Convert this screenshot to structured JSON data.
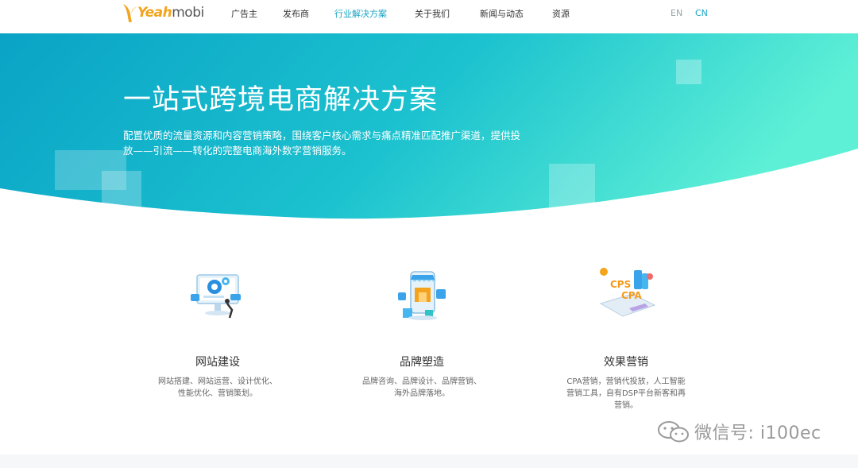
{
  "header": {
    "logo_highlight": "Yeah",
    "logo_rest": "mobi",
    "nav": [
      {
        "label": "广告主",
        "active": false
      },
      {
        "label": "发布商",
        "active": false
      },
      {
        "label": "行业解决方案",
        "active": true
      },
      {
        "label": "关于我们",
        "active": false
      },
      {
        "label": "新闻与动态",
        "active": false
      },
      {
        "label": "资源",
        "active": false
      }
    ],
    "lang_en": "EN",
    "lang_cn": "CN"
  },
  "hero": {
    "title": "一站式跨境电商解决方案",
    "description": "配置优质的流量资源和内容营销策略，围绕客户核心需求与痛点精准匹配推广渠道，提供投放——引流——转化的完整电商海外数字营销服务。"
  },
  "services": [
    {
      "icon": "website-build-icon",
      "title": "网站建设",
      "desc_line1": "网站搭建、网站运营、设计优化、",
      "desc_line2": "性能优化、营销策划。",
      "desc_line3": ""
    },
    {
      "icon": "brand-store-icon",
      "title": "品牌塑造",
      "desc_line1": "品牌咨询、品牌设计、品牌营销、",
      "desc_line2": "海外品牌落地。",
      "desc_line3": ""
    },
    {
      "icon": "performance-marketing-icon",
      "title": "效果营销",
      "desc_line1": "CPA营销，营销代投放，人工智能",
      "desc_line2": "营销工具，自有DSP平台新客和再",
      "desc_line3": "营销。"
    }
  ],
  "watermark": {
    "text": "微信号: i100ec"
  },
  "colors": {
    "accent": "#1aa6c6",
    "hero_start": "#0aa6c9",
    "hero_end": "#5ef0d6",
    "logo": "#f3a31c"
  }
}
